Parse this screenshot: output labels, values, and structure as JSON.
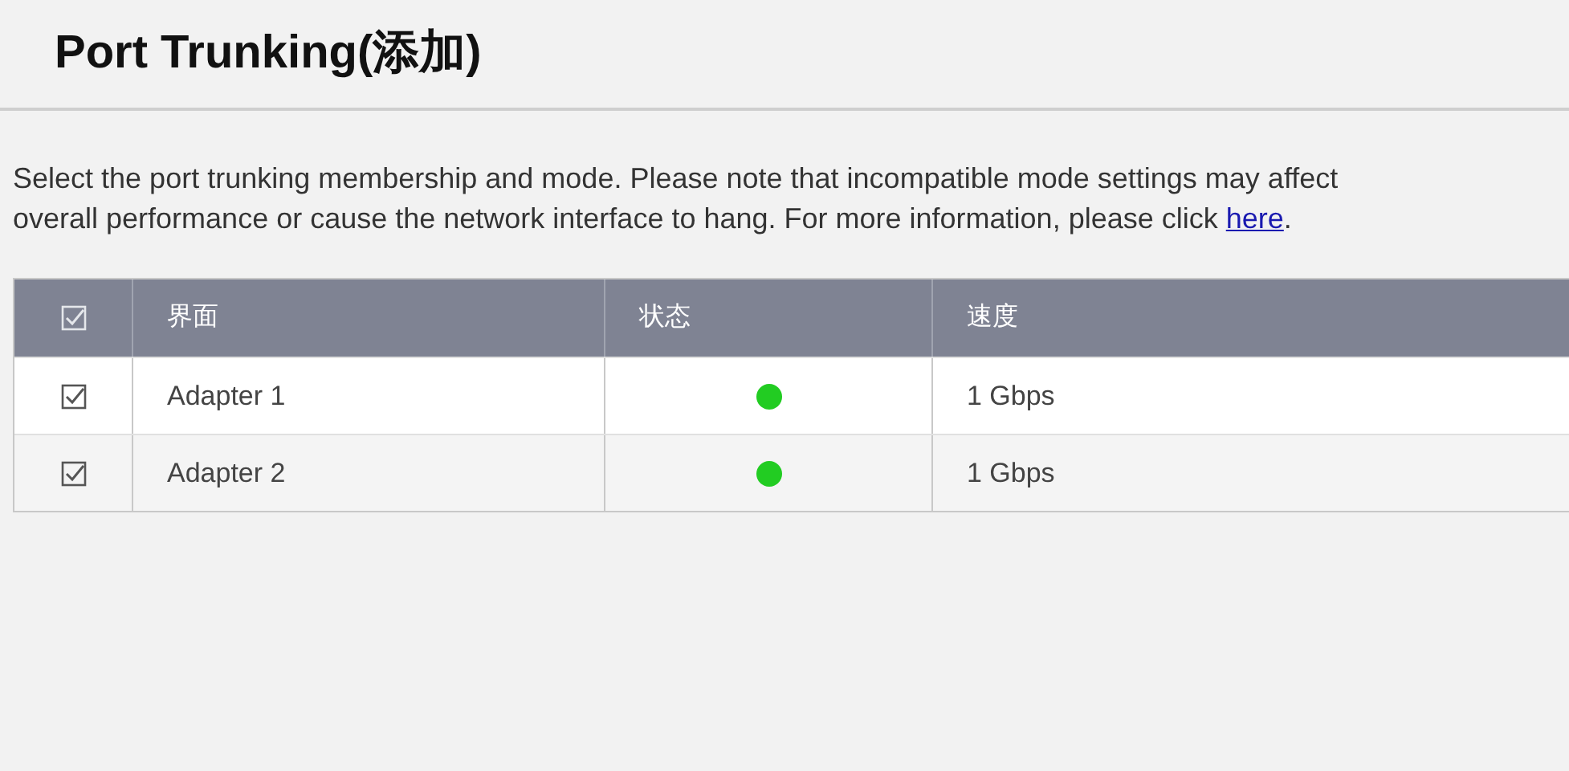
{
  "title": "Port Trunking(添加)",
  "description": {
    "text": "Select the port trunking membership and mode. Please note that incompatible mode settings may affect overall performance or cause the network interface to hang. For more information, please click",
    "link": "here",
    "end": "."
  },
  "table": {
    "select_all": {
      "checked": true
    },
    "columns": [
      "界面",
      "状态",
      "速度"
    ],
    "rows": [
      {
        "checked": true,
        "interface": "Adapter 1",
        "color": "#22cc22",
        "speed": "1 Gbps"
      },
      {
        "checked": true,
        "interface": "Adapter 2",
        "color": "#22cc22",
        "speed": "1 Gbps"
      }
    ]
  }
}
